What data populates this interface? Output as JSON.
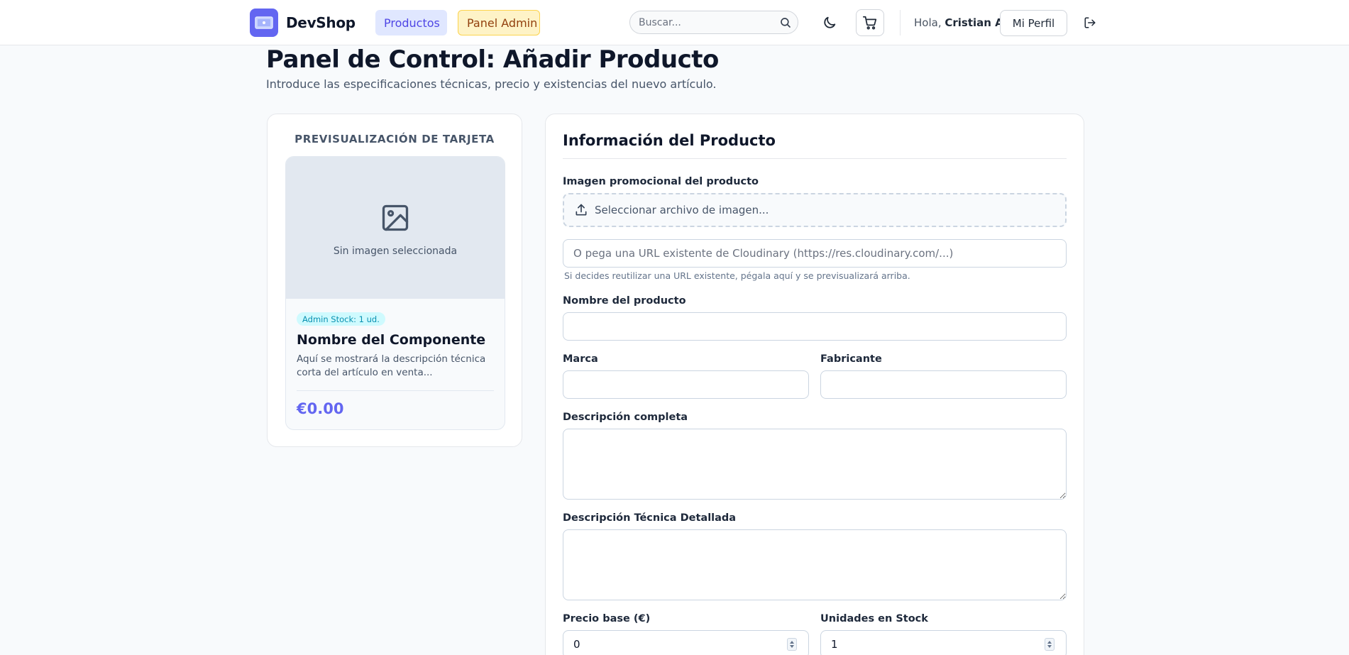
{
  "header": {
    "brand": "DevShop",
    "nav": {
      "products": "Productos",
      "admin": "Panel Admin"
    },
    "search": {
      "placeholder": "Buscar..."
    },
    "greeting_prefix": "Hola,",
    "user_name": "Cristian A",
    "profile_label": "Mi Perfil",
    "icons": {
      "logo": "logo-icon",
      "search": "search-icon",
      "theme": "moon-icon",
      "cart": "cart-icon",
      "logout": "logout-icon"
    }
  },
  "page": {
    "title": "Panel de Control: Añadir Producto",
    "subtitle": "Introduce las especificaciones técnicas, precio y existencias del nuevo artículo."
  },
  "preview": {
    "heading": "PREVISUALIZACIÓN DE TARJETA",
    "no_image": "Sin imagen seleccionada",
    "stock_badge": "Admin Stock: 1 ud.",
    "name": "Nombre del Componente",
    "description": "Aquí se mostrará la descripción técnica corta del artículo en venta...",
    "price": "€0.00"
  },
  "form": {
    "title": "Información del Producto",
    "image_label": "Imagen promocional del producto",
    "upload_label": "Seleccionar archivo de imagen...",
    "url_placeholder": "O pega una URL existente de Cloudinary (https://res.cloudinary.com/...)",
    "url_hint": "Si decides reutilizar una URL existente, pégala aquí y se previsualizará arriba.",
    "name_label": "Nombre del producto",
    "brand_label": "Marca",
    "maker_label": "Fabricante",
    "desc_label": "Descripción completa",
    "tech_label": "Descripción Técnica Detallada",
    "price_label": "Precio base (€)",
    "price_value": "0",
    "stock_label": "Unidades en Stock",
    "stock_value": "1"
  },
  "colors": {
    "accent": "#6366f1",
    "admin_bg": "#fef3c7",
    "admin_text": "#92400e",
    "badge_bg": "#cffafe",
    "badge_text": "#0891b2"
  }
}
